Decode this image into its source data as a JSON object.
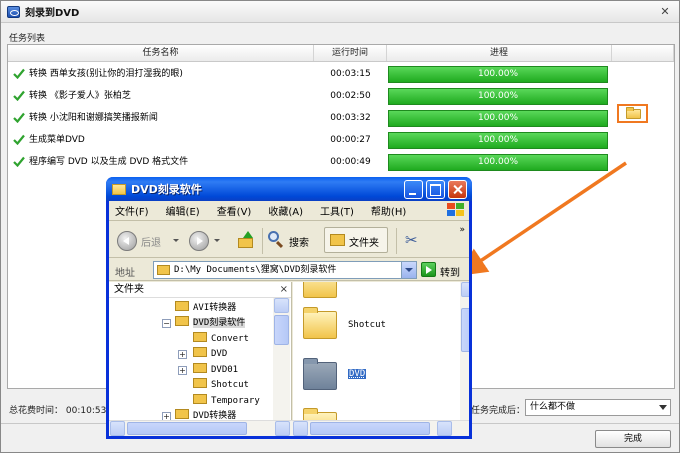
{
  "window": {
    "title": "刻录到DVD",
    "close_label": "✕"
  },
  "task_list": {
    "caption": "任务列表",
    "columns": {
      "name": "任务名称",
      "time": "运行时间",
      "progress": "进程"
    },
    "rows": [
      {
        "name": "转换 西单女孩(别让你的泪打湿我的眼)",
        "time": "00:03:15",
        "progress": "100.00%"
      },
      {
        "name": "转换 《影子爱人》张柏芝",
        "time": "00:02:50",
        "progress": "100.00%"
      },
      {
        "name": "转换 小沈阳和谢娜搞笑播报新闻",
        "time": "00:03:32",
        "progress": "100.00%"
      },
      {
        "name": "生成菜单DVD",
        "time": "00:00:27",
        "progress": "100.00%"
      },
      {
        "name": "程序编写 DVD 以及生成 DVD 格式文件",
        "time": "00:00:49",
        "progress": "100.00%"
      }
    ]
  },
  "footer": {
    "elapsed_label": "总花费时间：",
    "elapsed_value": "00:10:53",
    "after_label": "任务完成后：",
    "after_value": "什么都不做",
    "finish_button": "完成"
  },
  "explorer": {
    "title": "DVD刻录软件",
    "menu": [
      "文件(F)",
      "编辑(E)",
      "查看(V)",
      "收藏(A)",
      "工具(T)",
      "帮助(H)"
    ],
    "toolbar": {
      "back": "后退",
      "search": "搜索",
      "folders": "文件夹",
      "more": "»"
    },
    "address": {
      "label": "地址",
      "path": "D:\\My Documents\\狸窝\\DVD刻录软件",
      "go": "转到"
    },
    "tree": {
      "header": "文件夹",
      "close": "×",
      "items": [
        "AVI转换器",
        "DVD刻录软件",
        "Convert",
        "DVD",
        "DVD01",
        "Shotcut",
        "Temporary",
        "DVD转换器"
      ]
    },
    "files": [
      {
        "name": ""
      },
      {
        "name": "Shotcut"
      },
      {
        "name": "DVD"
      },
      {
        "name": ""
      }
    ]
  },
  "colors": {
    "progress_green": "#2fbf2f",
    "callout_orange": "#f07820",
    "xp_blue": "#0a3fc4"
  }
}
